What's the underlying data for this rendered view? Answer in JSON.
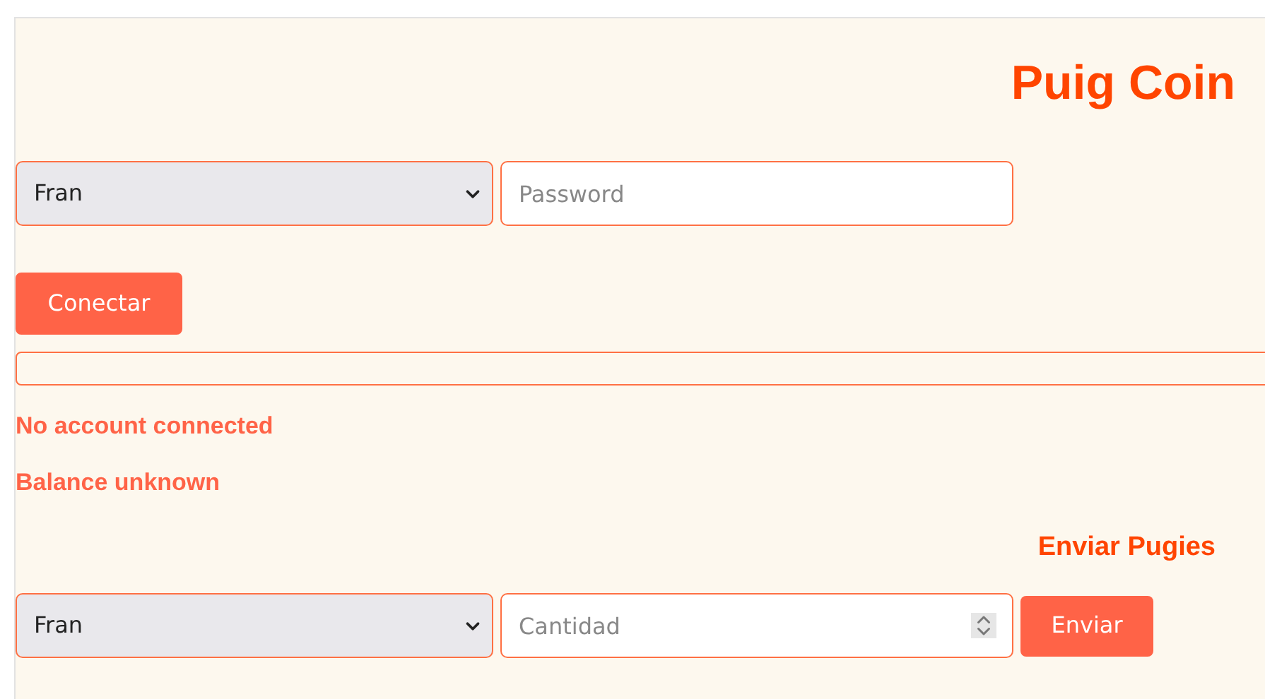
{
  "title": "Puig Coin",
  "login": {
    "account": "Fran",
    "password": {
      "placeholder": "Password"
    },
    "button": "Conectar"
  },
  "status": [
    "No account connected",
    "Balance unknown"
  ],
  "send": {
    "title": "Enviar Pugies",
    "account": "Fran",
    "amount": {
      "placeholder": "Cantidad"
    },
    "button": "Enviar"
  }
}
